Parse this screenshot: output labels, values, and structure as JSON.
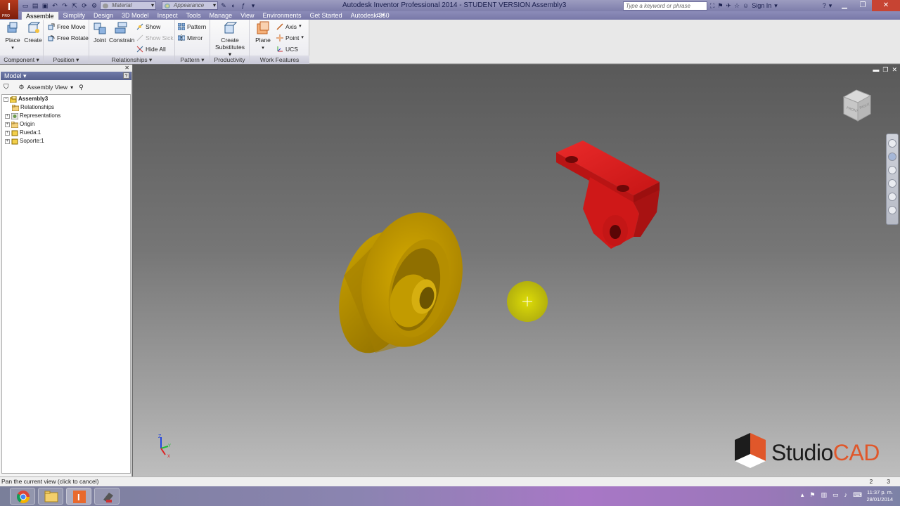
{
  "window": {
    "title": "Autodesk Inventor Professional 2014 - STUDENT VERSION     Assembly3",
    "app_logo_letter": "I",
    "app_logo_sub": "PRO",
    "search_placeholder": "Type a keyword or phrase",
    "sign_in": "Sign In"
  },
  "qat": {
    "material_placeholder": "Material",
    "appearance_placeholder": "Appearance"
  },
  "tabs": [
    {
      "label": "Assemble",
      "active": true
    },
    {
      "label": "Simplify"
    },
    {
      "label": "Design"
    },
    {
      "label": "3D Model"
    },
    {
      "label": "Inspect"
    },
    {
      "label": "Tools"
    },
    {
      "label": "Manage"
    },
    {
      "label": "View"
    },
    {
      "label": "Environments"
    },
    {
      "label": "Get Started"
    },
    {
      "label": "Autodesk 360"
    }
  ],
  "ribbon": {
    "component": {
      "title": "Component",
      "place": "Place",
      "create": "Create"
    },
    "position": {
      "title": "Position",
      "free_move": "Free Move",
      "free_rotate": "Free Rotate"
    },
    "relationships": {
      "title": "Relationships",
      "joint": "Joint",
      "constrain": "Constrain",
      "show": "Show",
      "show_sick": "Show Sick",
      "hide_all": "Hide All"
    },
    "pattern": {
      "title": "Pattern",
      "pattern": "Pattern",
      "mirror": "Mirror"
    },
    "productivity": {
      "title": "Productivity",
      "create_substitutes_1": "Create",
      "create_substitutes_2": "Substitutes"
    },
    "work_features": {
      "title": "Work Features",
      "plane": "Plane",
      "axis": "Axis",
      "point": "Point",
      "ucs": "UCS"
    }
  },
  "browser": {
    "title": "Model",
    "view_mode": "Assembly View",
    "tree": [
      {
        "label": "Assembly3",
        "root": true
      },
      {
        "label": "Relationships"
      },
      {
        "label": "Representations"
      },
      {
        "label": "Origin"
      },
      {
        "label": "Rueda:1"
      },
      {
        "label": "Soporte:1"
      }
    ]
  },
  "viewport": {
    "viewcube_labels": [
      "FRONT",
      "RIGHT"
    ],
    "triad_labels": [
      "Z",
      "Y",
      "X"
    ],
    "colors": {
      "wheel": "#c9a000",
      "bracket": "#d81f1f",
      "pointer": "#d6d400"
    }
  },
  "watermark": {
    "studio": "Studio",
    "cad": "CAD"
  },
  "status": {
    "message": "Pan the current view (click to cancel)",
    "num1": "2",
    "num2": "3"
  },
  "taskbar": {
    "time": "11:37 p. m.",
    "date": "28/01/2014"
  }
}
